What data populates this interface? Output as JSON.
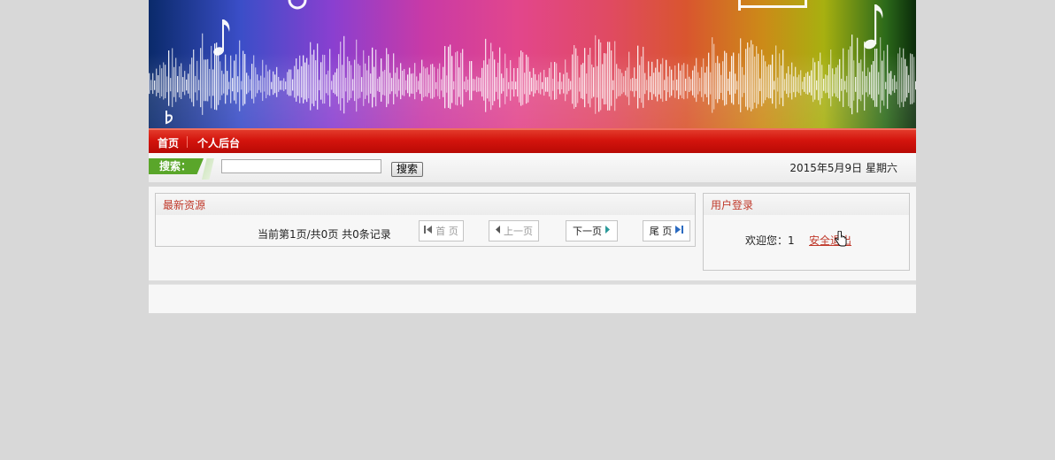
{
  "nav": {
    "items": [
      {
        "label": "首页"
      },
      {
        "label": "个人后台"
      }
    ]
  },
  "search": {
    "tag_label": "搜索：",
    "input_value": "",
    "button_label": "搜索"
  },
  "date_text": "2015年5月9日 星期六",
  "resources": {
    "title": "最新资源",
    "pager_info": "当前第1页/共0页  共0条记录",
    "buttons": {
      "first": "首 页",
      "prev": "上一页",
      "next": "下一页",
      "last": "尾 页"
    }
  },
  "login": {
    "title": "用户登录",
    "welcome": "欢迎您：1",
    "logout": "安全退出"
  },
  "colors": {
    "nav_red": "#d4140d",
    "accent_text": "#c0392b",
    "search_tag_green": "#5aa62a",
    "page_bg": "#d8d8d8"
  },
  "icons": {
    "first": "skip-first-icon",
    "prev": "chevron-left-icon",
    "next": "chevron-right-icon",
    "last": "skip-last-icon",
    "cursor": "hand-pointer-icon"
  }
}
